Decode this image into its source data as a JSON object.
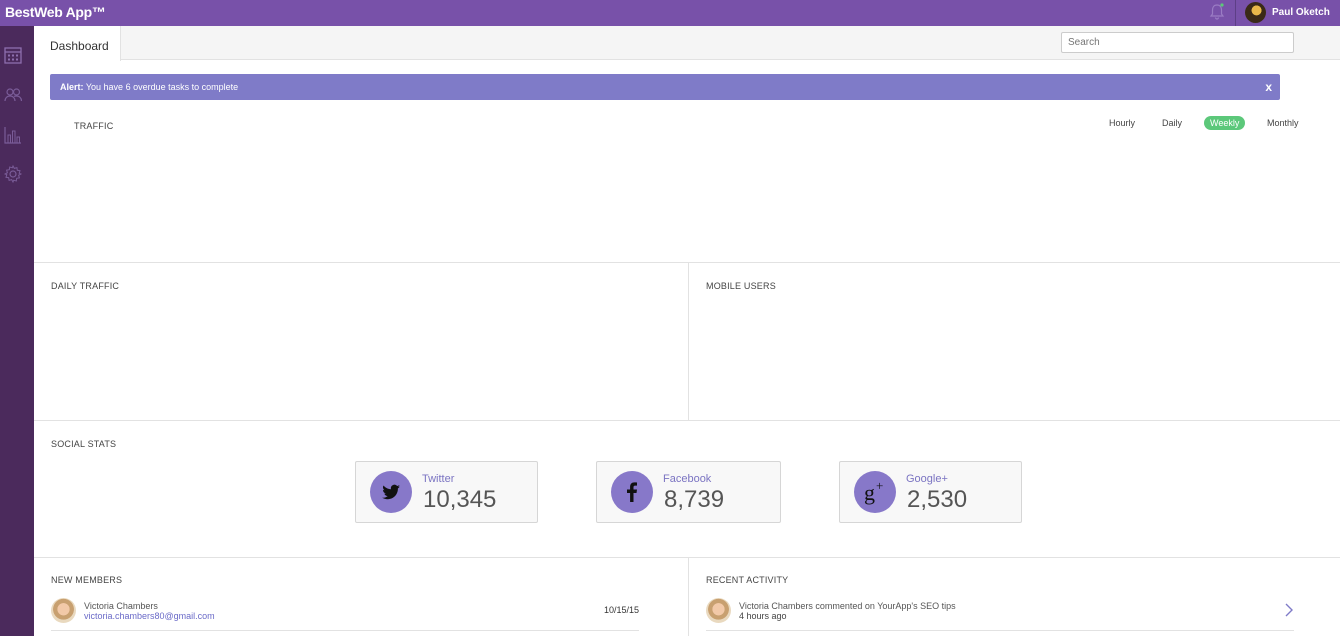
{
  "app": {
    "brand": "BestWeb App™",
    "user_name": "Paul Oketch"
  },
  "sidebar": {
    "icons": [
      "calendar-icon",
      "users-icon",
      "bar-chart-icon",
      "gear-icon"
    ]
  },
  "tabs": {
    "active": "Dashboard"
  },
  "search": {
    "placeholder": "Search"
  },
  "alert": {
    "prefix": "Alert:",
    "message": "You have 6 overdue tasks to complete",
    "close": "x"
  },
  "traffic": {
    "title": "TRAFFIC",
    "filters": [
      "Hourly",
      "Daily",
      "Weekly",
      "Monthly"
    ],
    "selected": "Weekly"
  },
  "daily_traffic": {
    "title": "DAILY TRAFFIC"
  },
  "mobile_users": {
    "title": "MOBILE USERS"
  },
  "social": {
    "title": "SOCIAL STATS",
    "cards": [
      {
        "name": "Twitter",
        "value": "10,345",
        "icon": "twitter-icon"
      },
      {
        "name": "Facebook",
        "value": "8,739",
        "icon": "facebook-icon"
      },
      {
        "name": "Google+",
        "value": "2,530",
        "icon": "google-plus-icon"
      }
    ]
  },
  "new_members": {
    "title": "NEW MEMBERS",
    "rows": [
      {
        "name": "Victoria Chambers",
        "email": "victoria.chambers80@gmail.com",
        "date": "10/15/15"
      }
    ]
  },
  "recent_activity": {
    "title": "RECENT ACTIVITY",
    "rows": [
      {
        "text": "Victoria Chambers commented on YourApp's SEO tips",
        "time": "4 hours ago"
      }
    ]
  },
  "colors": {
    "topbar": "#7851a9",
    "sidebar": "#4b2a5c",
    "alert": "#7f7bc8",
    "active_pill": "#5cc87a",
    "social_circle": "#8778c9"
  }
}
